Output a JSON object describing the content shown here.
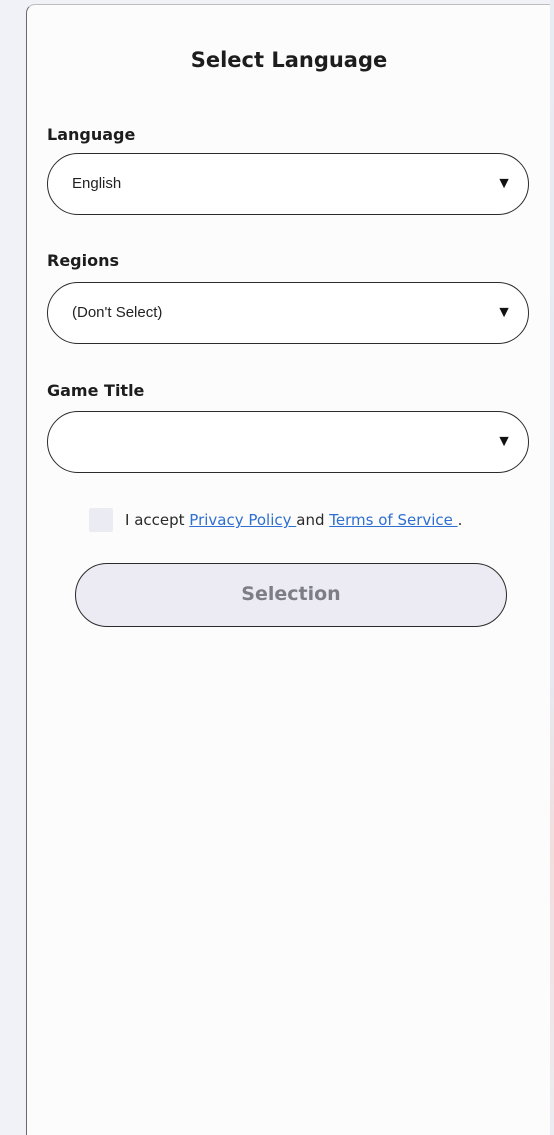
{
  "dialog": {
    "title": "Select Language"
  },
  "fields": {
    "language": {
      "label": "Language",
      "value": "English"
    },
    "regions": {
      "label": "Regions",
      "value": "(Don't Select)"
    },
    "game_title": {
      "label": "Game Title",
      "value": ""
    }
  },
  "dropdown_arrow": "▼",
  "consent": {
    "prefix": "I accept ",
    "privacy_link": "Privacy Policy ",
    "middle": "and ",
    "terms_link": "Terms of Service ",
    "suffix": ".",
    "checked": false
  },
  "selection_button": {
    "label": "Selection",
    "enabled": false
  },
  "colors": {
    "link": "#2e6fd0",
    "button_bg": "#ecebf4",
    "button_text": "#7d7d85",
    "checkbox_bg": "#ebebf3"
  },
  "icons": {
    "dropdown": "chevron-down-icon"
  }
}
